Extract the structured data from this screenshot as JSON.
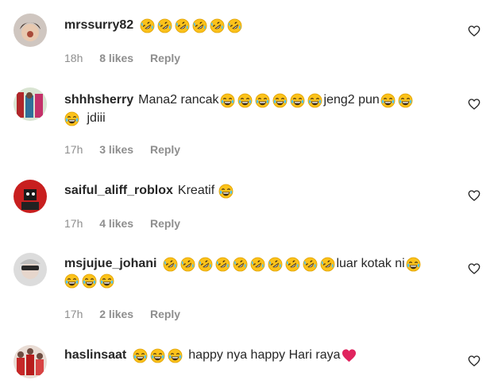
{
  "comments": [
    {
      "username": "mrssurry82",
      "line1_text": "",
      "line1_emojis": 6,
      "line1_after": "",
      "time": "18h",
      "likes": "8 likes",
      "reply": "Reply",
      "emoji_type": "rofl"
    },
    {
      "username": "shhhsherry",
      "line1_text": "Mana2 rancak",
      "line1_after": "jeng2 pun",
      "line2_text": "jdiii",
      "time": "17h",
      "likes": "3 likes",
      "reply": "Reply",
      "emoji_type": "joy"
    },
    {
      "username": "saiful_aliff_roblox",
      "line1_text": "Kreatif",
      "time": "17h",
      "likes": "4 likes",
      "reply": "Reply",
      "emoji_type": "joy"
    },
    {
      "username": "msjujue_johani",
      "line1_after": "luar kotak ni",
      "time": "17h",
      "likes": "2 likes",
      "reply": "Reply",
      "emoji_type": "rofl"
    },
    {
      "username": "haslinsaat",
      "line1_text": "happy nya happy Hari raya",
      "emoji_type": "joy"
    }
  ],
  "icons": {
    "like": "heart-outline-icon",
    "rofl": "rolling-on-floor-laughing-emoji",
    "joy": "face-with-tears-of-joy-emoji",
    "red_heart": "red-heart-emoji"
  },
  "colors": {
    "text": "#262626",
    "meta": "#8e8e8e",
    "emoji_yellow": "#fbc02d",
    "heart_red": "#e0245e"
  }
}
